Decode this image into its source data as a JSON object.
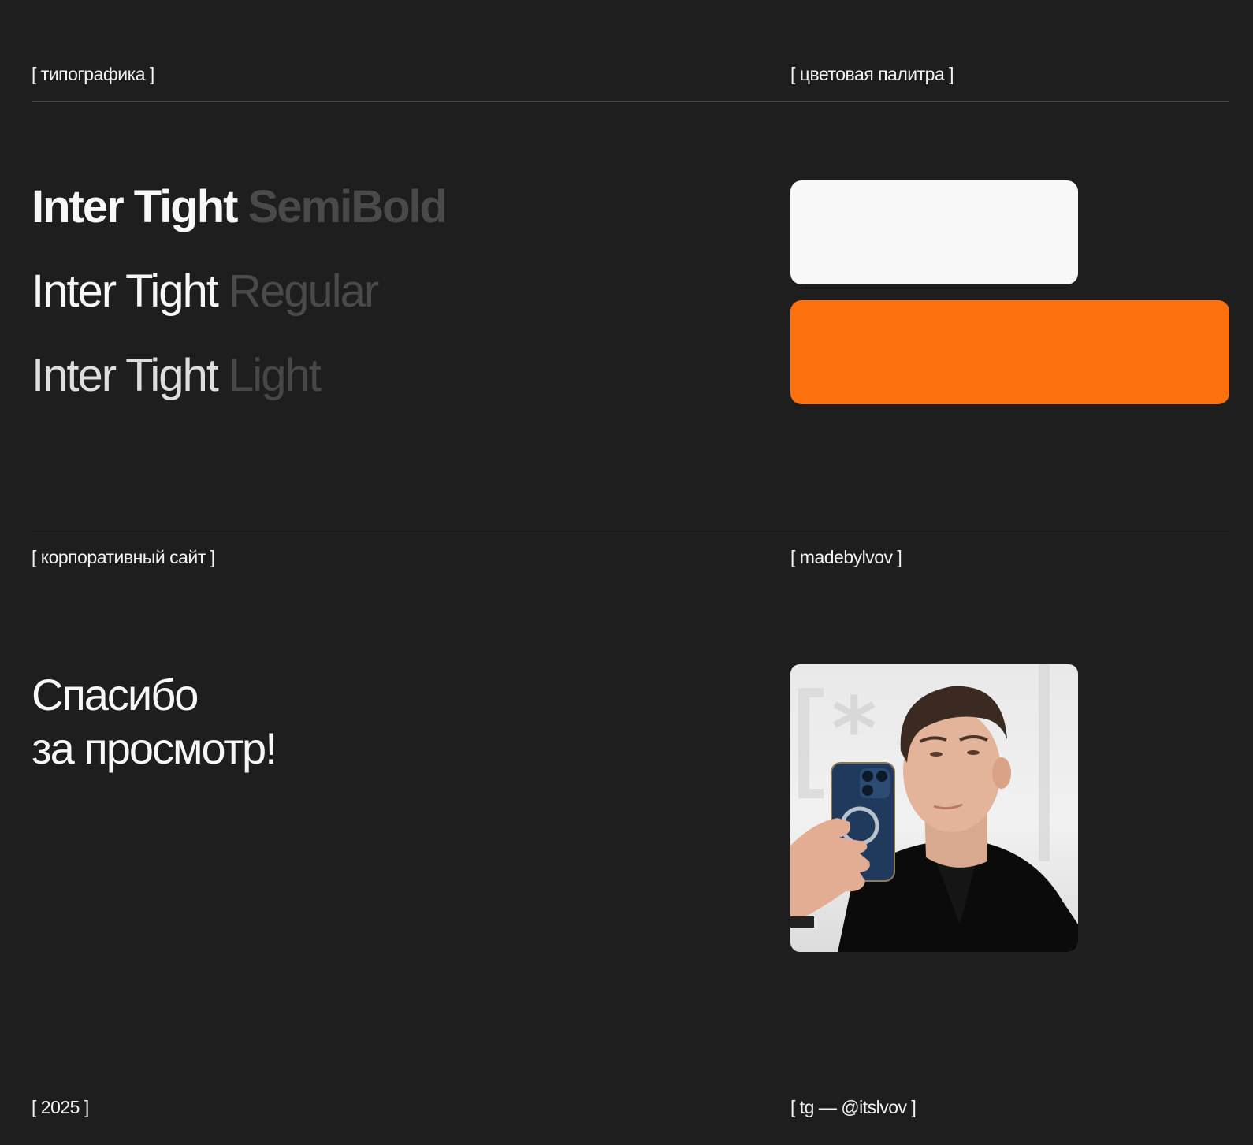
{
  "sections": {
    "typography_label": "[ типографика ]",
    "palette_label": "[ цветовая палитра ]",
    "site_label": "[ корпоративный сайт ]",
    "author_label": "[ madebylvov ]",
    "year_label": "[ 2025 ]",
    "contact_label": "[ tg — @itslvov ]"
  },
  "typography": {
    "font_name": "Inter Tight",
    "weights": [
      "SemiBold",
      "Regular",
      "Light"
    ]
  },
  "palette": {
    "colors": [
      "#f8f8f8",
      "#ff700f"
    ]
  },
  "thanks": {
    "line1": "Спасибо",
    "line2": "за просмотр!"
  },
  "photo": {
    "icon": "portrait-photo"
  }
}
